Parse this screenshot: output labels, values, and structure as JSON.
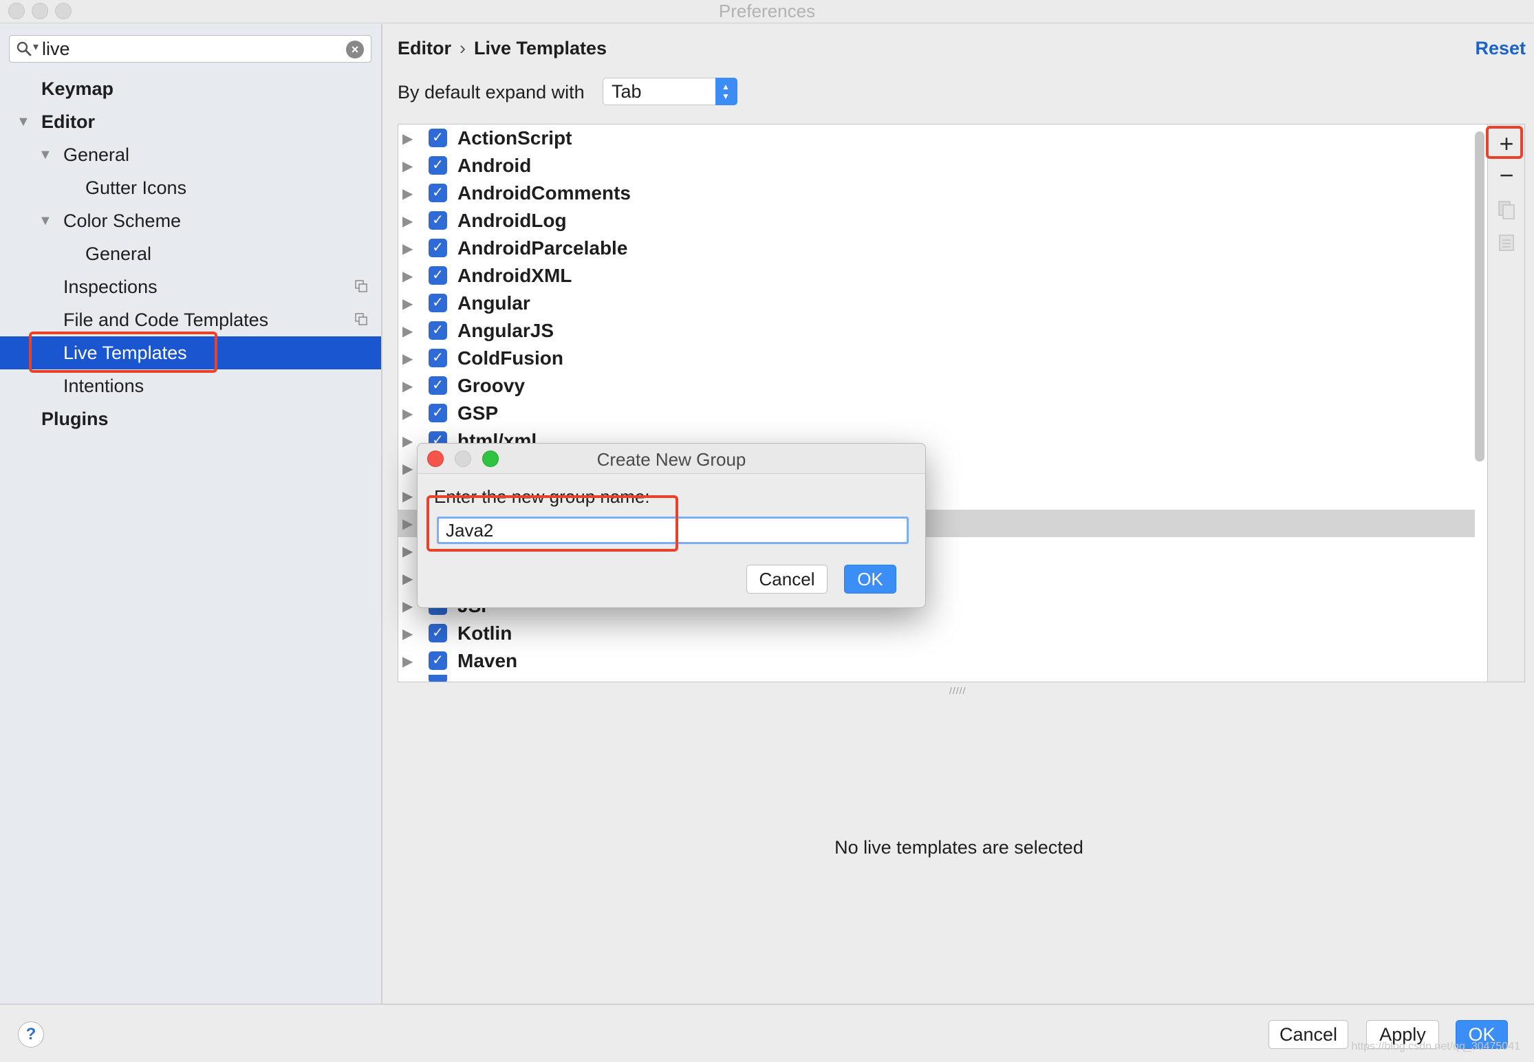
{
  "window": {
    "title": "Preferences"
  },
  "search": {
    "value": "live"
  },
  "sidebar": {
    "items": [
      {
        "label": "Keymap"
      },
      {
        "label": "Editor"
      },
      {
        "label": "General"
      },
      {
        "label": "Gutter Icons"
      },
      {
        "label": "Color Scheme"
      },
      {
        "label": "General"
      },
      {
        "label": "Inspections"
      },
      {
        "label": "File and Code Templates"
      },
      {
        "label": "Live Templates"
      },
      {
        "label": "Intentions"
      },
      {
        "label": "Plugins"
      }
    ]
  },
  "header": {
    "breadcrumb_parent": "Editor",
    "breadcrumb_current": "Live Templates",
    "reset_label": "Reset"
  },
  "expand": {
    "label": "By default expand with",
    "value": "Tab"
  },
  "templates": [
    "ActionScript",
    "Android",
    "AndroidComments",
    "AndroidLog",
    "AndroidParcelable",
    "AndroidXML",
    "Angular",
    "AngularJS",
    "ColdFusion",
    "Groovy",
    "GSP",
    "html/xml",
    "",
    "",
    "",
    "",
    "",
    "JSP",
    "Kotlin",
    "Maven"
  ],
  "empty_message": "No live templates are selected",
  "dialog": {
    "title": "Create New Group",
    "prompt": "Enter the new group name:",
    "value": "Java2",
    "cancel_label": "Cancel",
    "ok_label": "OK"
  },
  "footer": {
    "help_label": "?",
    "cancel_label": "Cancel",
    "apply_label": "Apply",
    "ok_label": "OK",
    "watermark": "https://blog.csdn.net/qq_30475041"
  },
  "colors": {
    "selection": "#1a56cf",
    "accent": "#3a8ef6",
    "highlight_box": "#e8432a",
    "link": "#1a63c7"
  }
}
